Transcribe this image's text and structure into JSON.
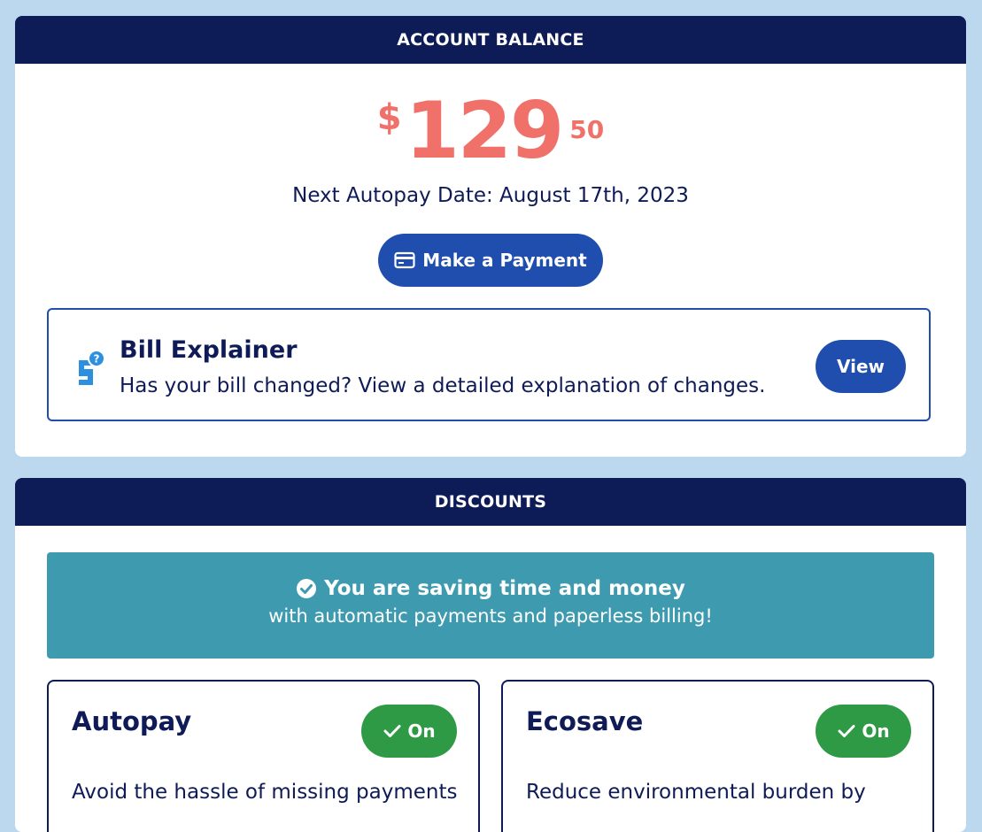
{
  "balance": {
    "header": "ACCOUNT BALANCE",
    "currency_symbol": "$",
    "amount_whole": "129",
    "amount_cents": "50",
    "autopay_date_text": "Next Autopay Date: August 17th, 2023",
    "pay_button_label": "Make a Payment",
    "pay_button_icon": "credit-card-icon"
  },
  "bill_explainer": {
    "icon": "bill-question-icon",
    "title": "Bill Explainer",
    "description": "Has your bill changed? View a detailed explanation of changes.",
    "button_label": "View"
  },
  "discounts": {
    "header": "DISCOUNTS",
    "banner_icon": "check-circle-icon",
    "banner_title": "You are saving time and money",
    "banner_subtitle": "with automatic payments and paperless billing!",
    "items": [
      {
        "title": "Autopay",
        "status": "On",
        "status_icon": "check-icon",
        "description": "Avoid the hassle of missing payments"
      },
      {
        "title": "Ecosave",
        "status": "On",
        "status_icon": "check-icon",
        "description": "Reduce environmental burden by"
      }
    ]
  },
  "colors": {
    "page_background": "#bcd8ef",
    "header_navy": "#0d1b57",
    "balance_coral": "#f0706a",
    "primary_blue": "#1f4eaf",
    "banner_teal": "#3e9baf",
    "toggle_green": "#2f9a45"
  }
}
